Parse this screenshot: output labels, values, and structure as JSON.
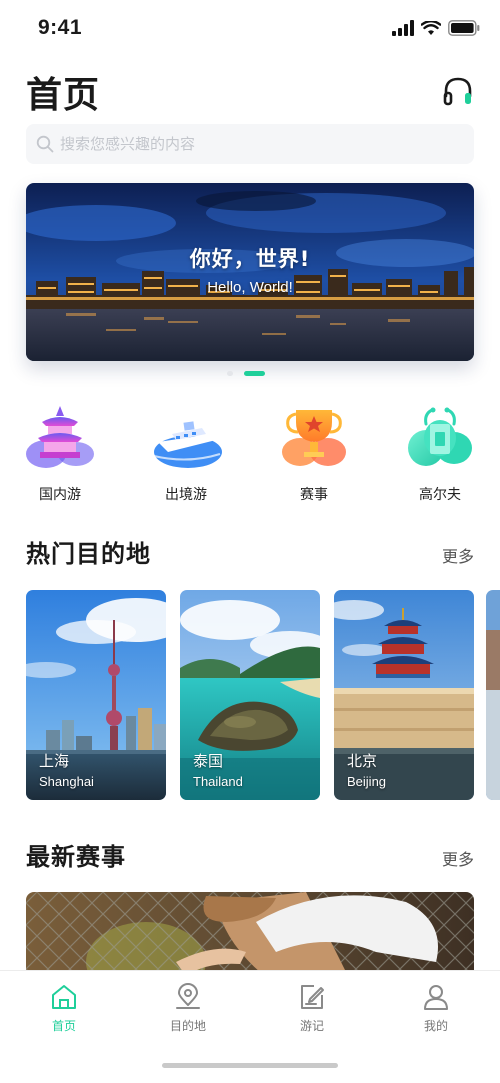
{
  "status": {
    "time": "9:41"
  },
  "header": {
    "title": "首页",
    "service_icon": "headset-icon"
  },
  "search": {
    "placeholder": "搜索您感兴趣的内容",
    "icon": "search-icon"
  },
  "banner": {
    "title": "你好，世界!",
    "subtitle": "Hello, World!",
    "slide_index": 2,
    "slide_count": 2
  },
  "categories": [
    {
      "label": "国内游",
      "icon": "pagoda-icon"
    },
    {
      "label": "出境游",
      "icon": "cruise-ship-icon"
    },
    {
      "label": "赛事",
      "icon": "trophy-icon"
    },
    {
      "label": "高尔夫",
      "icon": "golf-icon"
    }
  ],
  "hot_destinations": {
    "title": "热门目的地",
    "more": "更多",
    "items": [
      {
        "cn": "上海",
        "en": "Shanghai"
      },
      {
        "cn": "泰国",
        "en": "Thailand"
      },
      {
        "cn": "北京",
        "en": "Beijing"
      }
    ]
  },
  "latest_events": {
    "title": "最新赛事",
    "more": "更多"
  },
  "tabs": [
    {
      "label": "首页",
      "icon": "home-icon",
      "active": true
    },
    {
      "label": "目的地",
      "icon": "location-pin-icon",
      "active": false
    },
    {
      "label": "游记",
      "icon": "edit-note-icon",
      "active": false
    },
    {
      "label": "我的",
      "icon": "user-icon",
      "active": false
    }
  ],
  "colors": {
    "accent": "#1fcf9a",
    "text": "#1a1a1a",
    "muted": "#777777",
    "search_bg": "#f5f6f8"
  }
}
